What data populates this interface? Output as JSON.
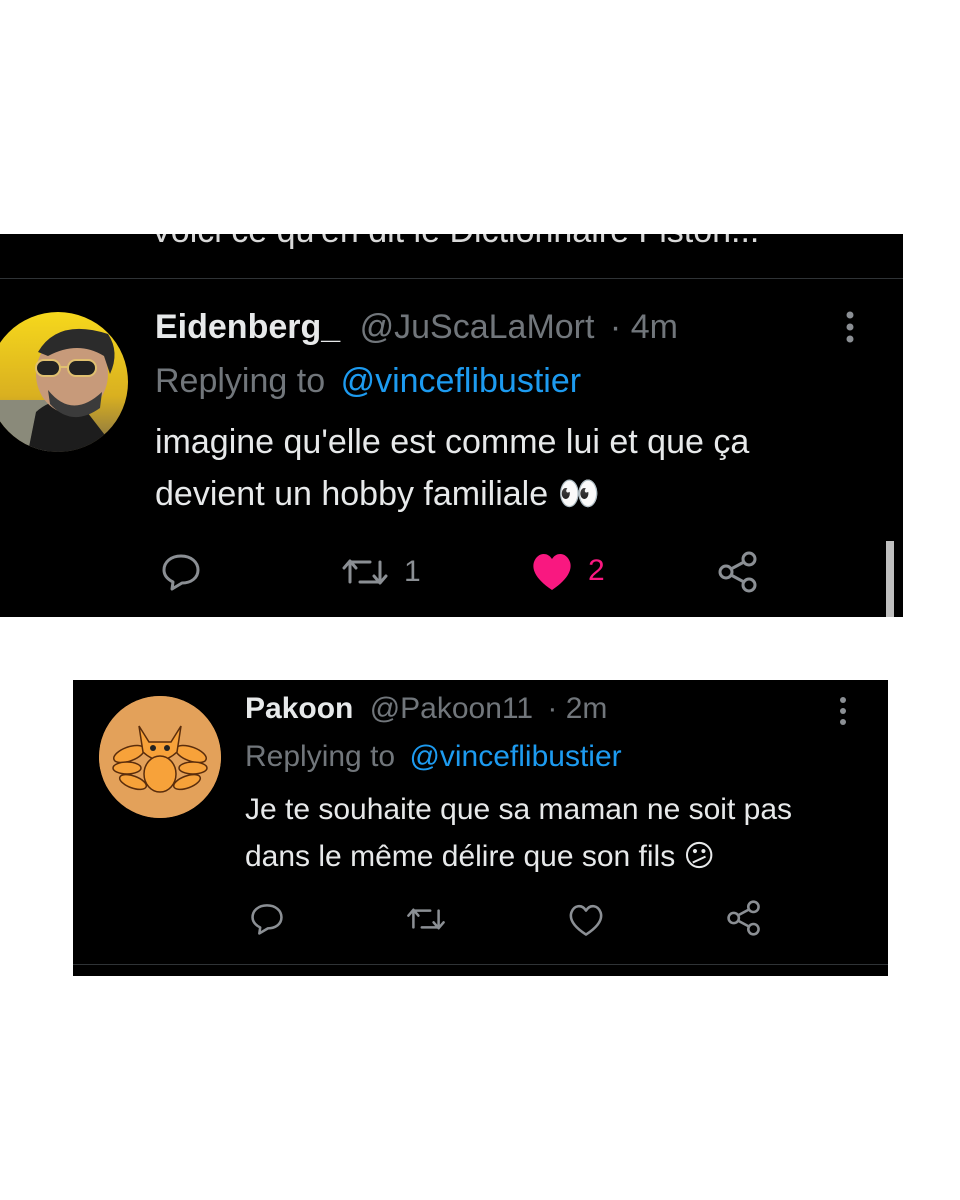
{
  "tweet1": {
    "cut_text": "Voici ce qu'en dit le Dictionnaire Fiston...",
    "display_name": "Eidenberg_",
    "handle": "@JuScaLaMort",
    "time": "· 4m",
    "replying_label": "Replying to",
    "replying_to": "@vinceflibustier",
    "text_line1": "imagine qu'elle est comme lui et que ça",
    "text_line2": "devient un hobby familiale 👀",
    "retweet_count": "1",
    "like_count": "2",
    "liked": true
  },
  "tweet2": {
    "display_name": "Pakoon",
    "handle": "@Pakoon11",
    "time": "· 2m",
    "replying_label": "Replying to",
    "replying_to": "@vinceflibustier",
    "text_line1": "Je te souhaite que sa maman ne soit pas",
    "text_line2": "dans le même délire que son fils 😕",
    "liked": false
  },
  "icons": [
    "reply-icon",
    "retweet-icon",
    "like-icon",
    "share-icon",
    "more-icon"
  ],
  "colors": {
    "like": "#f91880",
    "link": "#1d9bf0",
    "muted": "#71767b",
    "text": "#e7e9ea"
  }
}
